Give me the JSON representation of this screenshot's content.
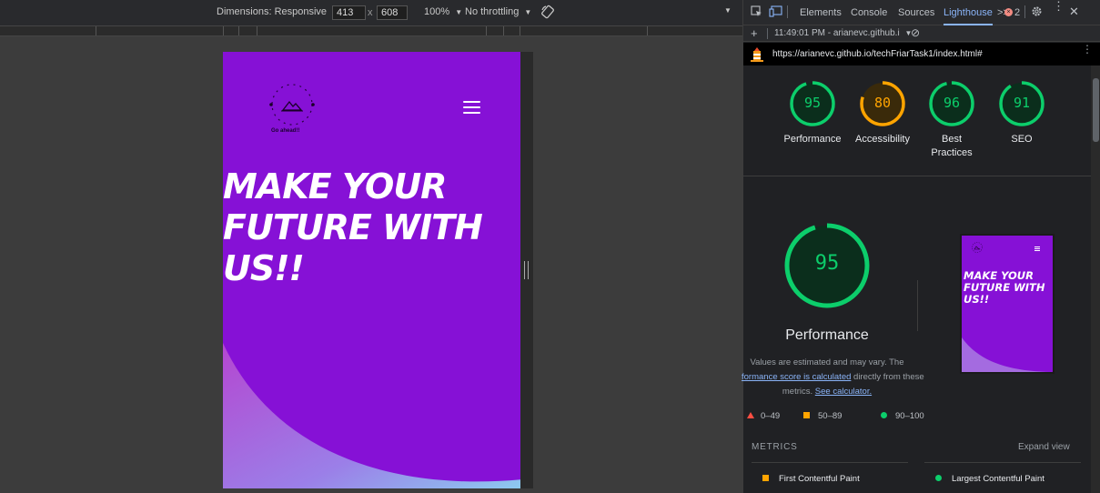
{
  "device_toolbar": {
    "dimensions_label": "Dimensions: Responsive",
    "width": "413",
    "times": "x",
    "height": "608",
    "zoom": "100%",
    "throttling": "No throttling",
    "dropdown_caret": "▼"
  },
  "emulated_page": {
    "logo_caption": "Go ahead!!",
    "hero_lines": [
      "MAKE YOUR",
      "FUTURE WITH",
      "US!!"
    ],
    "background_color": "#8611d6"
  },
  "devtools": {
    "tabs": [
      "Elements",
      "Console",
      "Sources",
      "Lighthouse"
    ],
    "active_tab": "Lighthouse",
    "more_tabs": ">>",
    "error_count": "2",
    "run_bar": {
      "add": "+",
      "report": "11:49:01 PM - arianevc.github.i",
      "caret": "▼",
      "clear": "⊘"
    },
    "url": "https://arianevc.github.io/techFriarTask1/index.html#",
    "scores": [
      {
        "label": "Performance",
        "value": 95,
        "color": "#0cce6b",
        "bg": "#0b2e1c"
      },
      {
        "label": "Accessibility",
        "value": 80,
        "color": "#ffa400",
        "bg": "#3a2a0a"
      },
      {
        "label_lines": [
          "Best",
          "Practices"
        ],
        "value": 96,
        "color": "#0cce6b",
        "bg": "#0b2e1c"
      },
      {
        "label": "SEO",
        "value": 91,
        "color": "#0cce6b",
        "bg": "#0b2e1c"
      }
    ],
    "main_score": {
      "value": 95,
      "title": "Performance"
    },
    "description": {
      "text1": "Values are estimated and may vary. The",
      "link1": "formance score is calculated",
      "text2": " directly from these",
      "text3": "metrics. ",
      "link2": "See calculator."
    },
    "thumbnail_hero_lines": [
      "MAKE YOUR",
      "FUTURE WITH",
      "US!!"
    ],
    "legend": {
      "fail": "0–49",
      "average": "50–89",
      "pass": "90–100"
    },
    "metrics_header": "METRICS",
    "expand_view": "Expand view",
    "metrics": [
      "First Contentful Paint",
      "Largest Contentful Paint"
    ],
    "colors": {
      "pass": "#0cce6b",
      "average": "#ffa400",
      "fail": "#ff4e42",
      "link": "#8ab4f8"
    }
  }
}
